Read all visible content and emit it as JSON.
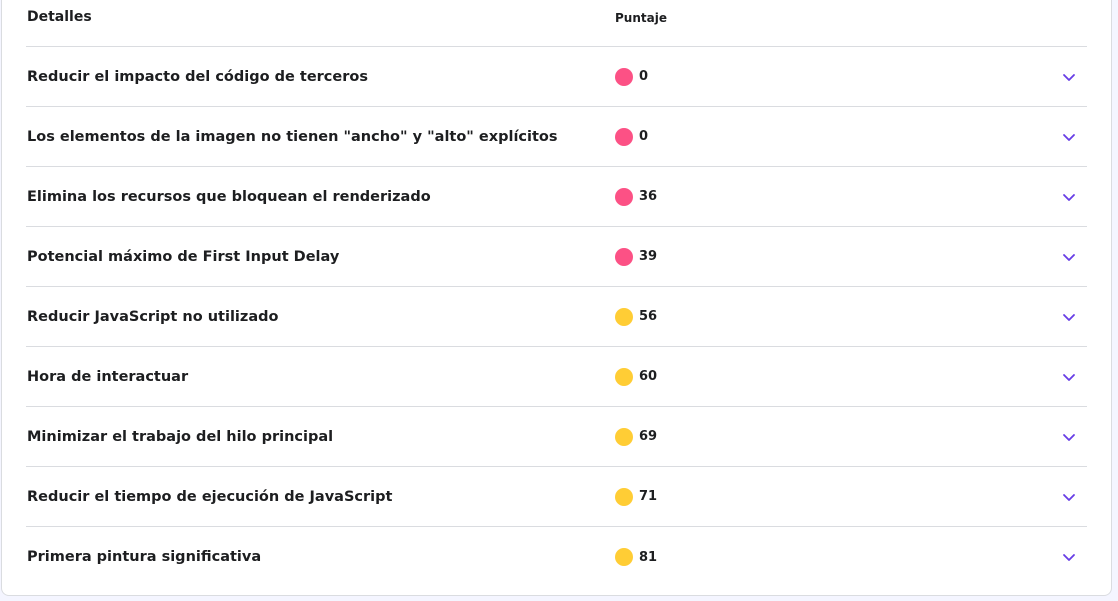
{
  "table": {
    "header": {
      "details": "Detalles",
      "score": "Puntaje"
    },
    "rows": [
      {
        "label": "Reducir el impacto del código de terceros",
        "score": "0",
        "status": "red"
      },
      {
        "label": "Los elementos de la imagen no tienen \"ancho\" y \"alto\" explícitos",
        "score": "0",
        "status": "red"
      },
      {
        "label": "Elimina los recursos que bloquean el renderizado",
        "score": "36",
        "status": "red"
      },
      {
        "label": "Potencial máximo de First Input Delay",
        "score": "39",
        "status": "red"
      },
      {
        "label": "Reducir JavaScript no utilizado",
        "score": "56",
        "status": "yellow"
      },
      {
        "label": "Hora de interactuar",
        "score": "60",
        "status": "yellow"
      },
      {
        "label": "Minimizar el trabajo del hilo principal",
        "score": "69",
        "status": "yellow"
      },
      {
        "label": "Reducir el tiempo de ejecución de JavaScript",
        "score": "71",
        "status": "yellow"
      },
      {
        "label": "Primera pintura significativa",
        "score": "81",
        "status": "yellow"
      }
    ]
  },
  "colors": {
    "red": "#fc5185",
    "yellow": "#ffcd35",
    "chevron": "#673de6"
  },
  "icons": {
    "expand": "chevron-down-icon",
    "status": "status-dot-icon"
  }
}
